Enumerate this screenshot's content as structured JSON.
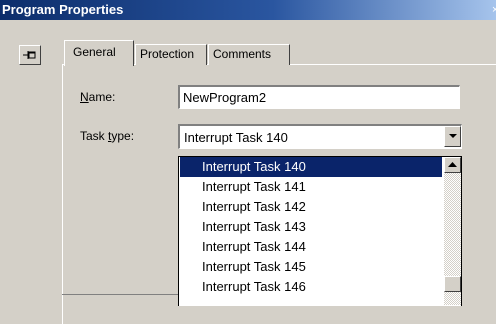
{
  "window": {
    "title": "Program Properties"
  },
  "tabs": [
    {
      "label": "General",
      "active": true
    },
    {
      "label": "Protection",
      "active": false
    },
    {
      "label": "Comments",
      "active": false
    }
  ],
  "form": {
    "name_label_accel": "N",
    "name_label_rest": "ame:",
    "name_value": "NewProgram2",
    "task_label_pre": "Task ",
    "task_label_accel": "t",
    "task_label_rest": "ype:",
    "task_value": "Interrupt Task 140"
  },
  "dropdown": {
    "options": [
      "Interrupt Task 140",
      "Interrupt Task 141",
      "Interrupt Task 142",
      "Interrupt Task 143",
      "Interrupt Task 144",
      "Interrupt Task 145",
      "Interrupt Task 146"
    ],
    "selected_index": 0
  },
  "icons": {
    "pin": "pin-icon",
    "dropdown_arrow": "chevron-down-icon",
    "scroll_up": "scroll-up-arrow-icon"
  },
  "colors": {
    "selection": "#0a246a",
    "title_start": "#0c2d6b",
    "face": "#d4d0c8"
  }
}
